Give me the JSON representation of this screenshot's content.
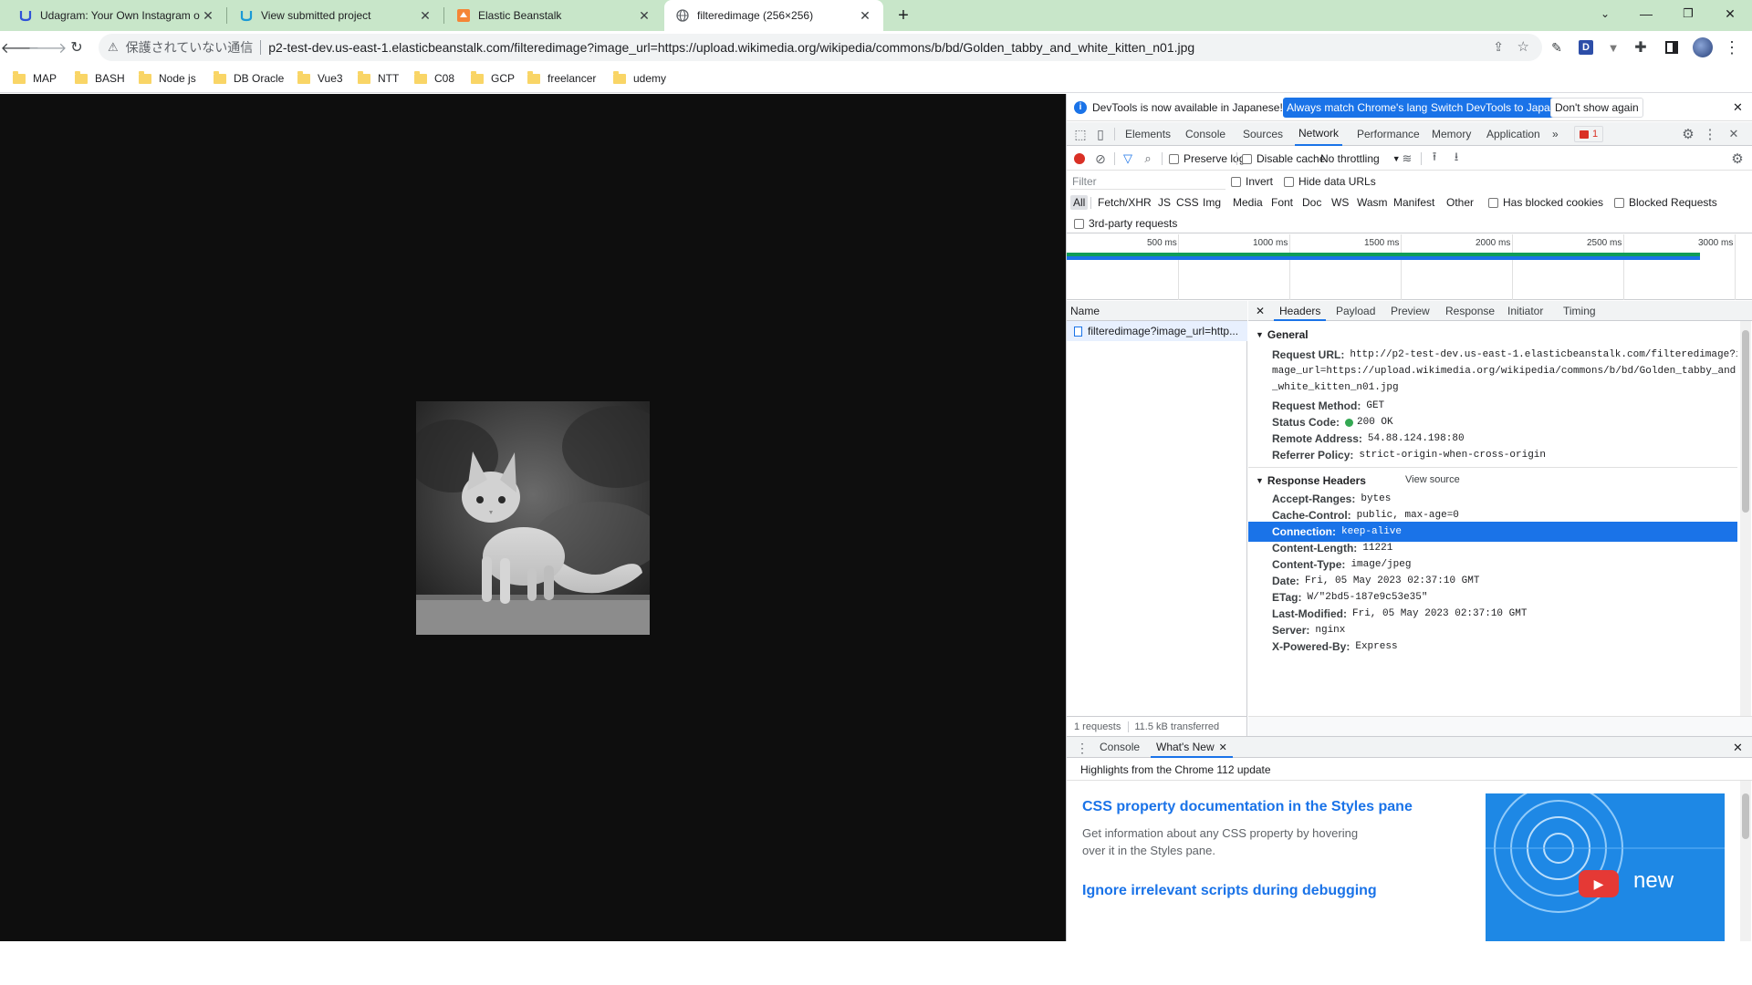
{
  "browser": {
    "tabs": [
      {
        "title": "Udagram: Your Own Instagram o",
        "icon": "udacity-icon"
      },
      {
        "title": "View submitted project",
        "icon": "udacity-icon"
      },
      {
        "title": "Elastic Beanstalk",
        "icon": "aws-icon"
      },
      {
        "title": "filteredimage (256×256)",
        "icon": "globe-icon"
      }
    ],
    "omnibox": {
      "security_label": "保護されていない通信",
      "url": "p2-test-dev.us-east-1.elasticbeanstalk.com/filteredimage?image_url=https://upload.wikimedia.org/wikipedia/commons/b/bd/Golden_tabby_and_white_kitten_n01.jpg"
    },
    "bookmarks": [
      "MAP",
      "BASH",
      "Node js",
      "DB Oracle",
      "Vue3",
      "NTT",
      "C08",
      "GCP",
      "freelancer",
      "udemy"
    ]
  },
  "devtools": {
    "infobar": {
      "message": "DevTools is now available in Japanese!",
      "btn_match": "Always match Chrome's language",
      "btn_switch": "Switch DevTools to Japanese",
      "btn_dismiss": "Don't show again"
    },
    "panels": [
      "Elements",
      "Console",
      "Sources",
      "Network",
      "Performance",
      "Memory",
      "Application"
    ],
    "issues_count": "1",
    "network_toolbar": {
      "preserve_log": "Preserve log",
      "disable_cache": "Disable cache",
      "throttling": "No throttling"
    },
    "filter": {
      "placeholder": "Filter",
      "invert": "Invert",
      "hide_data_urls": "Hide data URLs",
      "types": [
        "All",
        "Fetch/XHR",
        "JS",
        "CSS",
        "Img",
        "Media",
        "Font",
        "Doc",
        "WS",
        "Wasm",
        "Manifest",
        "Other"
      ],
      "has_blocked_cookies": "Has blocked cookies",
      "blocked_requests": "Blocked Requests",
      "third_party": "3rd-party requests"
    },
    "timeline": {
      "ticks": [
        "500 ms",
        "1000 ms",
        "1500 ms",
        "2000 ms",
        "2500 ms",
        "3000 ms"
      ]
    },
    "requests": {
      "name_header": "Name",
      "items": [
        "filteredimage?image_url=http..."
      ],
      "summary_requests": "1 requests",
      "summary_transferred": "11.5 kB transferred"
    },
    "detail_tabs": [
      "Headers",
      "Payload",
      "Preview",
      "Response",
      "Initiator",
      "Timing"
    ],
    "general": {
      "title": "General",
      "request_url_key": "Request URL:",
      "request_url_line1": "http://p2-test-dev.us-east-1.elasticbeanstalk.com/filteredimage?i",
      "request_url_line2": "mage_url=https://upload.wikimedia.org/wikipedia/commons/b/bd/Golden_tabby_and",
      "request_url_line3": "_white_kitten_n01.jpg",
      "method_key": "Request Method:",
      "method_val": "GET",
      "status_key": "Status Code:",
      "status_val": "200 OK",
      "remote_key": "Remote Address:",
      "remote_val": "54.88.124.198:80",
      "referrer_key": "Referrer Policy:",
      "referrer_val": "strict-origin-when-cross-origin"
    },
    "response_headers": {
      "title": "Response Headers",
      "view_source": "View source",
      "rows": [
        {
          "k": "Accept-Ranges:",
          "v": "bytes"
        },
        {
          "k": "Cache-Control:",
          "v": "public, max-age=0"
        },
        {
          "k": "Connection:",
          "v": "keep-alive"
        },
        {
          "k": "Content-Length:",
          "v": "11221"
        },
        {
          "k": "Content-Type:",
          "v": "image/jpeg"
        },
        {
          "k": "Date:",
          "v": "Fri, 05 May 2023 02:37:10 GMT"
        },
        {
          "k": "ETag:",
          "v": "W/\"2bd5-187e9c53e35\""
        },
        {
          "k": "Last-Modified:",
          "v": "Fri, 05 May 2023 02:37:10 GMT"
        },
        {
          "k": "Server:",
          "v": "nginx"
        },
        {
          "k": "X-Powered-By:",
          "v": "Express"
        }
      ]
    },
    "drawer": {
      "tab_console": "Console",
      "tab_whats_new": "What's New",
      "highlights": "Highlights from the Chrome 112 update",
      "article1_title": "CSS property documentation in the Styles pane",
      "article1_body": "Get information about any CSS property by hovering over it in the Styles pane.",
      "article2_title": "Ignore irrelevant scripts during debugging",
      "video_badge": "new"
    }
  },
  "colors": {
    "tabstrip": "#c8e6c9",
    "accent": "#1a73e8",
    "page_bg": "#0e0e0e",
    "status_ok": "#34a853",
    "record": "#d93025"
  }
}
